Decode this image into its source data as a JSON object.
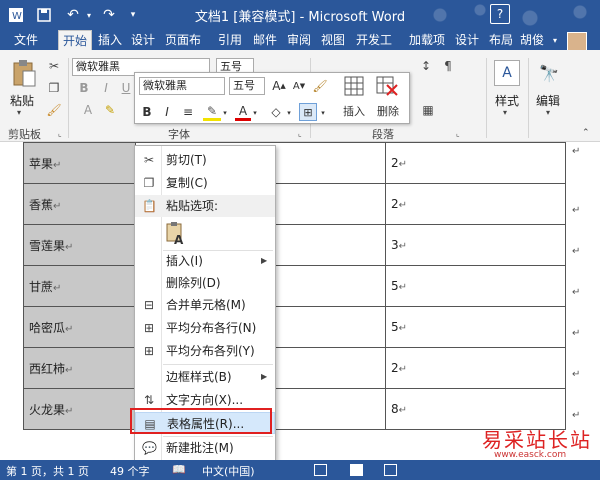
{
  "app": {
    "title": "文档1 [兼容模式] - Microsoft Word",
    "help": "?"
  },
  "tabs": [
    {
      "label": "文件"
    },
    {
      "label": "开始"
    },
    {
      "label": "插入"
    },
    {
      "label": "设计"
    },
    {
      "label": "页面布"
    },
    {
      "label": "引用"
    },
    {
      "label": "邮件"
    },
    {
      "label": "审阅"
    },
    {
      "label": "视图"
    },
    {
      "label": "开发工"
    },
    {
      "label": "加载项"
    },
    {
      "label": "设计"
    },
    {
      "label": "布局"
    }
  ],
  "user": "胡俊",
  "ribbon": {
    "paste_label": "粘贴",
    "clipboard_label": "剪贴板",
    "font_label": "字体",
    "paragraph_label": "段落",
    "font_name": "微软雅黑",
    "font_size": "五号",
    "styles_label": "样式",
    "edit_label": "编辑"
  },
  "mini_toolbar": {
    "font_name": "微软雅黑",
    "font_size": "五号",
    "insert_label": "插入",
    "delete_label": "删除"
  },
  "table": {
    "rows": [
      {
        "name": "苹果",
        "value": "2"
      },
      {
        "name": "香蕉",
        "value": "2"
      },
      {
        "name": "雪莲果",
        "value": "3"
      },
      {
        "name": "甘蔗",
        "value": "5"
      },
      {
        "name": "哈密瓜",
        "value": "5"
      },
      {
        "name": "西红柿",
        "value": "2"
      },
      {
        "name": "火龙果",
        "value": "8"
      }
    ],
    "para_mark": "↵"
  },
  "context_menu": {
    "items": [
      {
        "label": "剪切(T)"
      },
      {
        "label": "复制(C)"
      },
      {
        "label": "粘贴选项:"
      },
      {
        "label": "插入(I)"
      },
      {
        "label": "删除列(D)"
      },
      {
        "label": "合并单元格(M)"
      },
      {
        "label": "平均分布各行(N)"
      },
      {
        "label": "平均分布各列(Y)"
      },
      {
        "label": "边框样式(B)"
      },
      {
        "label": "文字方向(X)..."
      },
      {
        "label": "表格属性(R)..."
      },
      {
        "label": "新建批注(M)"
      }
    ]
  },
  "status": {
    "page": "第 1 页，共 1 页",
    "words": "49 个字",
    "language": "中文(中国)"
  },
  "watermark": {
    "cn": "易采站长站",
    "url": "www.easck.com"
  },
  "colors": {
    "word_blue": "#2b579a",
    "highlight_box": "#e02020",
    "selection_gray": "#c8c8c8"
  }
}
